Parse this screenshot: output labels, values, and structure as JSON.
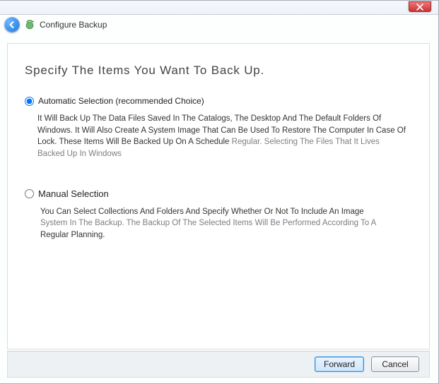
{
  "titlebar": {
    "close_label": "Close"
  },
  "nav": {
    "back_label": "Back",
    "breadcrumb": "Configure Backup"
  },
  "page": {
    "heading": "Specify The Items You Want To Back Up."
  },
  "options": {
    "auto": {
      "label": "Automatic Selection (recommended Choice)",
      "desc_main": "It Will Back Up The Data Files Saved In The Catalogs, The Desktop And The Default Folders Of Windows. It Will Also Create A System Image That Can Be Used To Restore The Computer In Case Of Lock. These Items Will Be Backed Up On A Schedule",
      "desc_muted": "Regular. Selecting The Files That It Lives Backed Up In Windows"
    },
    "manual": {
      "label": "Manual Selection",
      "desc_line1": "You Can Select Collections And Folders And Specify Whether Or Not To Include An Image",
      "desc_line2": "System In The Backup. The Backup Of The Selected Items Will Be Performed According To A",
      "desc_line3": "Regular Planning."
    }
  },
  "footer": {
    "forward": "Forward",
    "cancel": "Cancel"
  }
}
